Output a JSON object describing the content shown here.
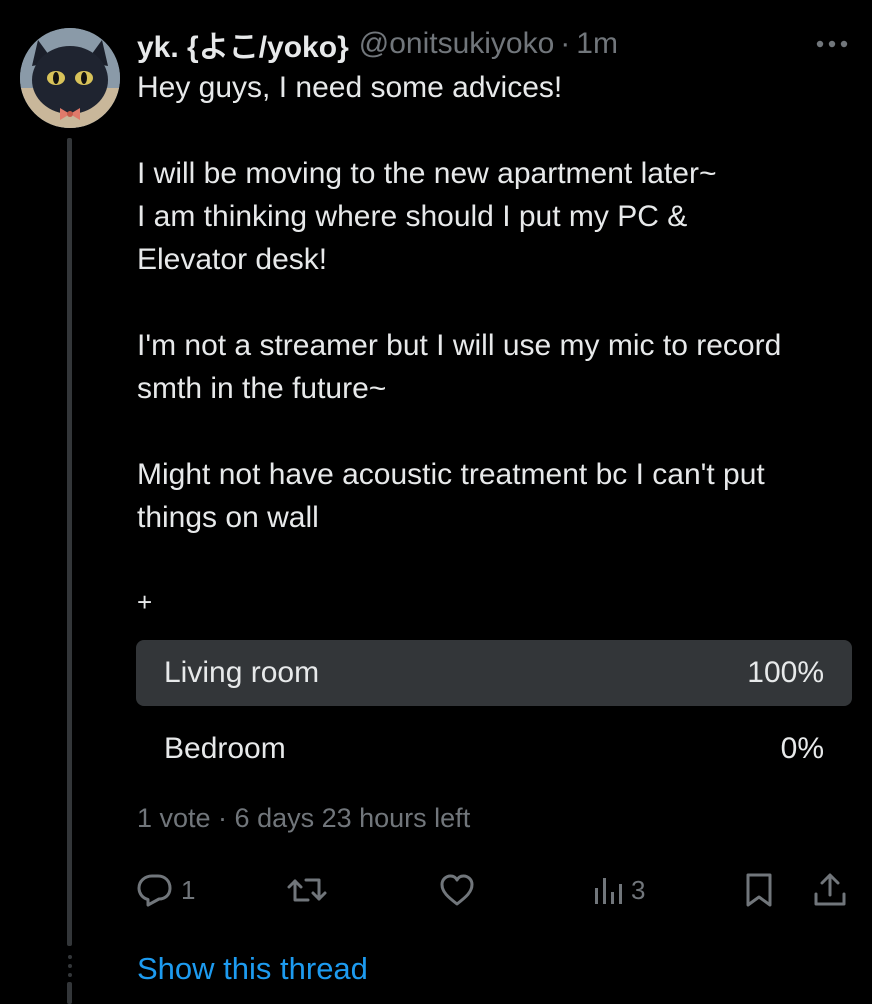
{
  "tweet": {
    "display_name": "yk. {よこ/yoko}",
    "handle": "@onitsukiyoko",
    "separator": "·",
    "time": "1m",
    "paragraphs": [
      "Hey guys, I need some advices!",
      "I will be moving to the new apartment later~\nI am thinking where should I put my PC &\nElevator desk!",
      "I'm not a streamer but I will use my mic to record\nsmth in the future~",
      "Might not have acoustic treatment bc I can't put\nthings on wall"
    ],
    "plus": "+"
  },
  "poll": {
    "options": [
      {
        "label": "Living room",
        "percent_label": "100%",
        "fraction": 1.0
      },
      {
        "label": "Bedroom",
        "percent_label": "0%",
        "fraction": 0.0
      }
    ],
    "meta": "1 vote · 6 days 23 hours left"
  },
  "actions": {
    "reply_count": "1",
    "views_count": "3"
  },
  "thread": {
    "show_label": "Show this thread"
  },
  "colors": {
    "background": "#000000",
    "text": "#e7e9ea",
    "muted": "#71767b",
    "poll_fill": "#333639",
    "link": "#1d9bf0"
  },
  "icons": {
    "more": "more-horizontal-icon",
    "reply": "reply-bubble-icon",
    "retweet": "retweet-icon",
    "like": "heart-icon",
    "views": "bar-chart-icon",
    "bookmark": "bookmark-icon",
    "share": "share-upload-icon"
  }
}
